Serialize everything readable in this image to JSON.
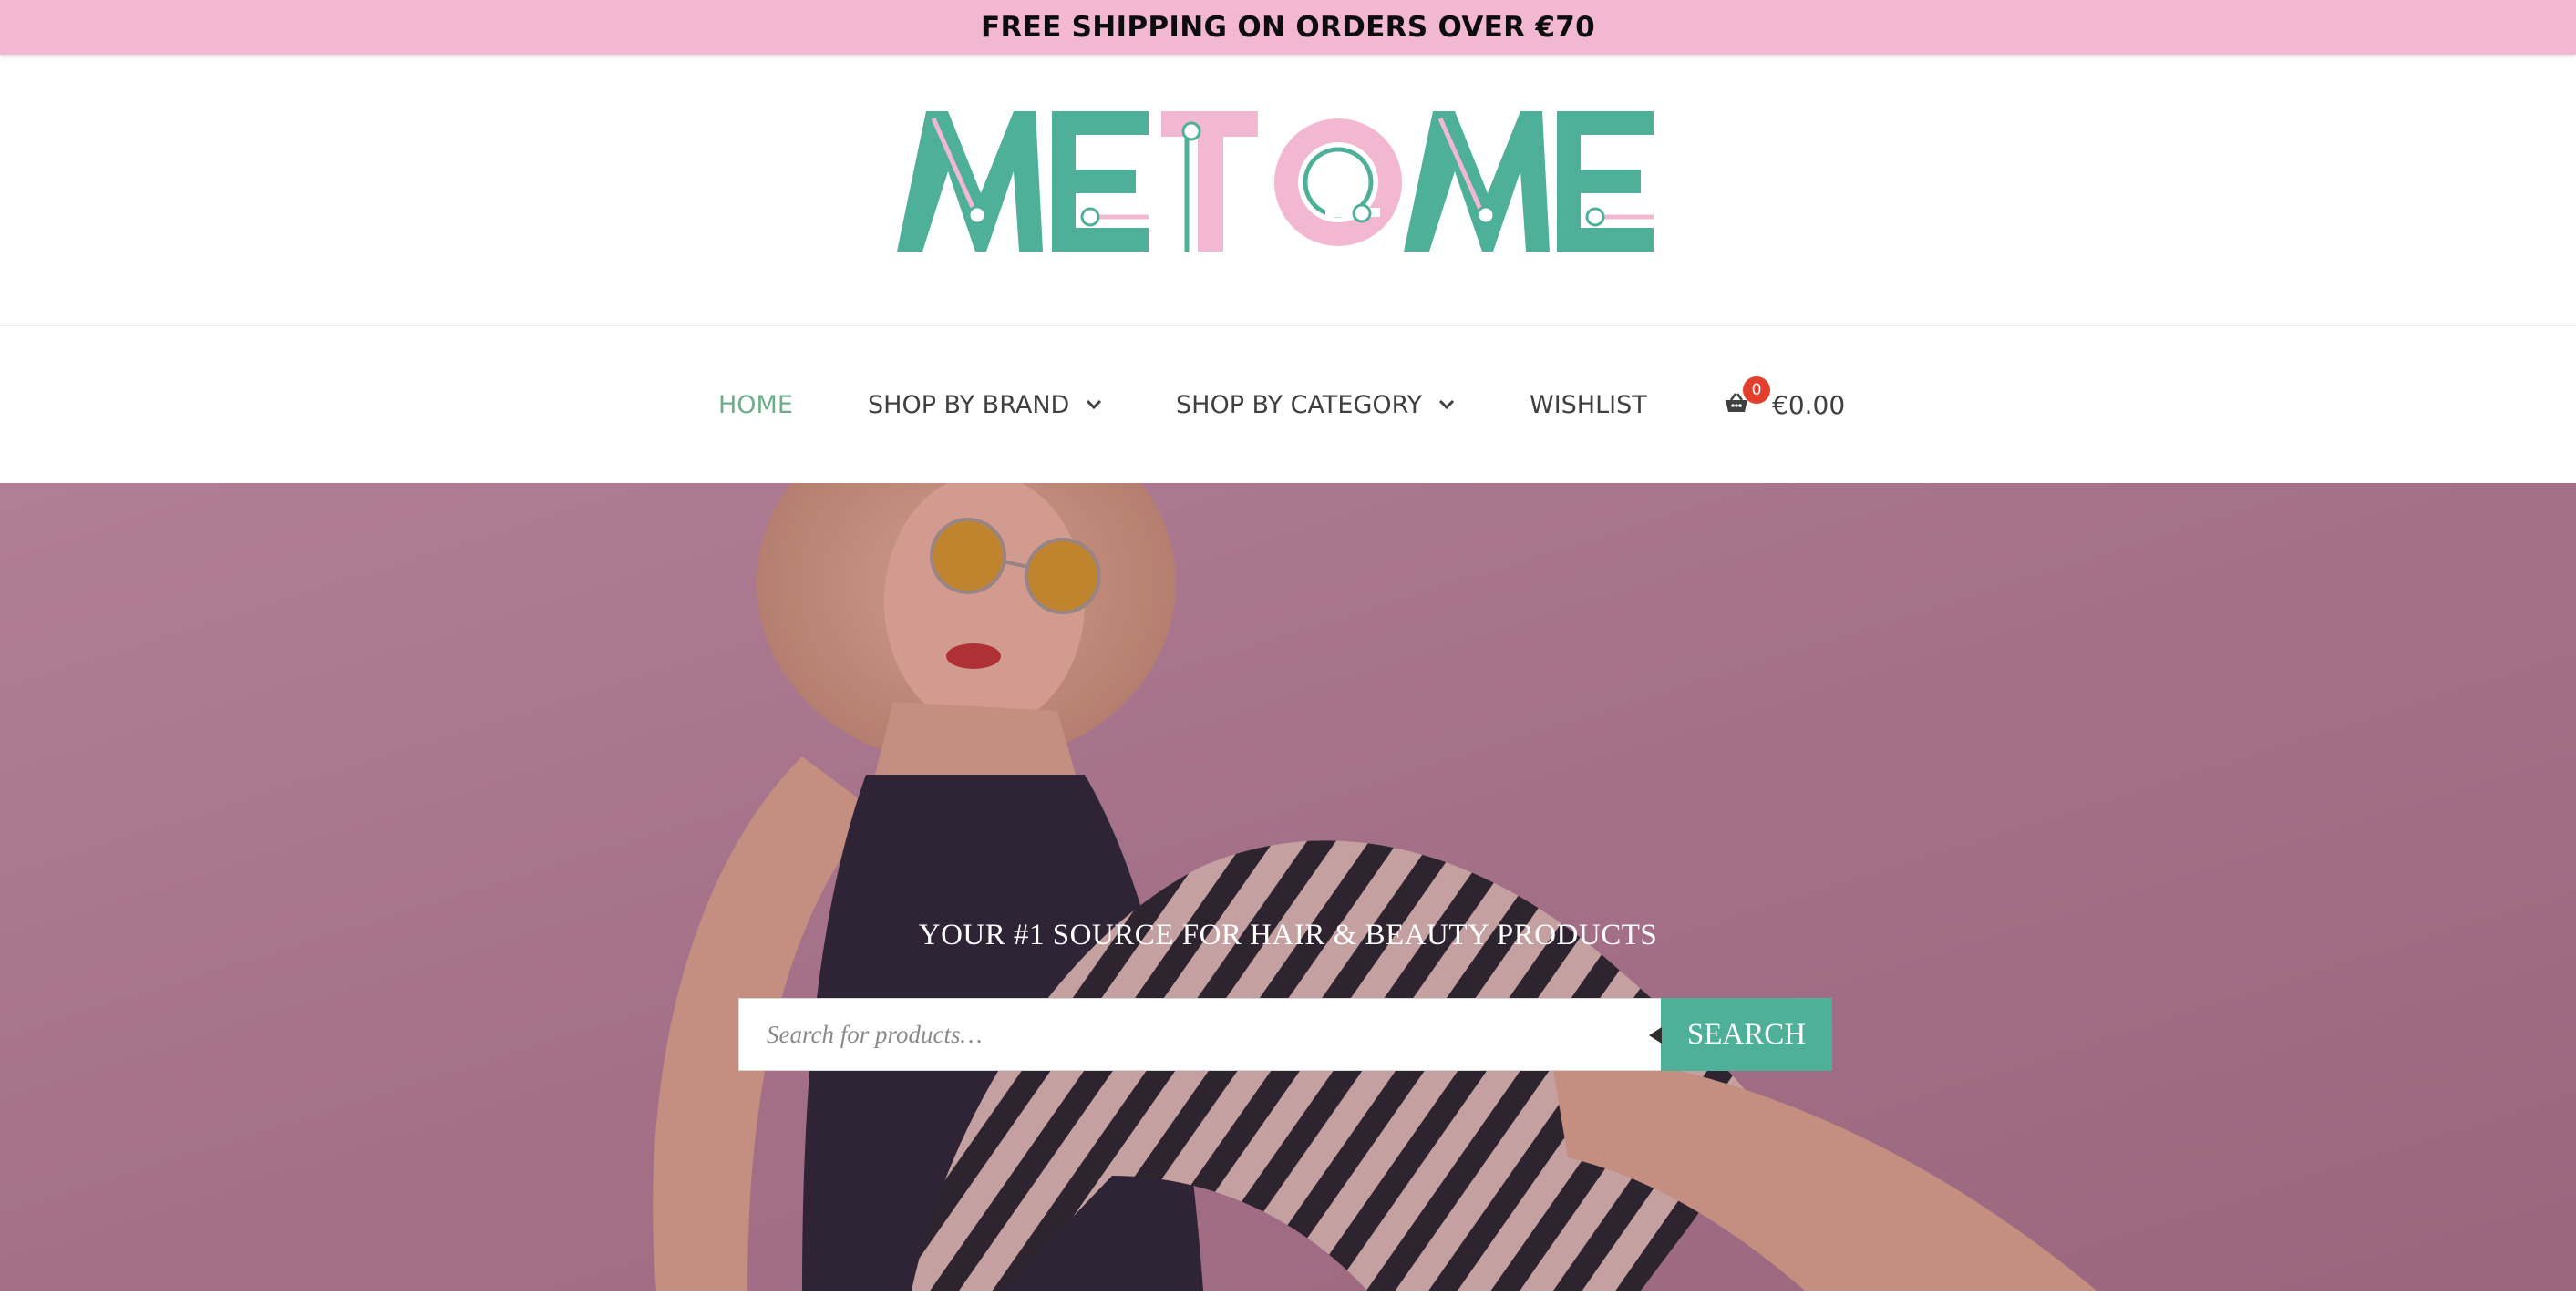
{
  "announcement": {
    "text": "FREE SHIPPING ON ORDERS OVER €70"
  },
  "brand": {
    "logo_text": "METOME",
    "colors": {
      "teal": "#4fb09a",
      "pink": "#f2b8d2",
      "active_nav": "#6cae8a",
      "badge": "#e2402d"
    }
  },
  "nav": {
    "home": "HOME",
    "shop_by_brand": "SHOP BY BRAND",
    "shop_by_category": "SHOP BY CATEGORY",
    "wishlist": "WISHLIST",
    "cart_count": "0",
    "cart_total": "€0.00"
  },
  "hero": {
    "tagline": "YOUR #1 SOURCE FOR HAIR & BEAUTY PRODUCTS",
    "search": {
      "placeholder": "Search for products…",
      "value": "",
      "button_label": "SEARCH"
    }
  },
  "icons": {
    "cart": "basket-icon",
    "dropdown": "chevron-down-icon",
    "search_pointer": "caret-left-icon"
  }
}
